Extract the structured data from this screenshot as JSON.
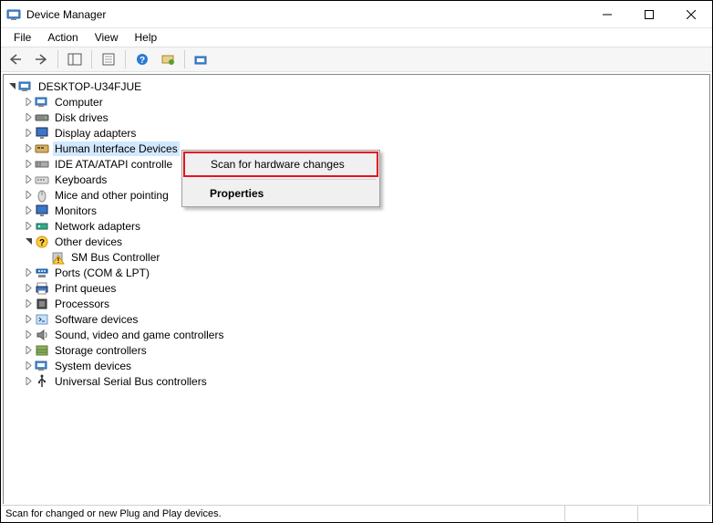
{
  "window": {
    "title": "Device Manager"
  },
  "menubar": {
    "file": "File",
    "action": "Action",
    "view": "View",
    "help": "Help"
  },
  "tree": {
    "root": "DESKTOP-U34FJUE",
    "nodes": [
      {
        "label": "Computer",
        "icon": "computer"
      },
      {
        "label": "Disk drives",
        "icon": "disk"
      },
      {
        "label": "Display adapters",
        "icon": "display"
      },
      {
        "label": "Human Interface Devices",
        "icon": "hid",
        "selected": true
      },
      {
        "label": "IDE ATA/ATAPI controllers",
        "icon": "ide",
        "truncated": "IDE ATA/ATAPI controlle"
      },
      {
        "label": "Keyboards",
        "icon": "keyboard"
      },
      {
        "label": "Mice and other pointing",
        "icon": "mouse"
      },
      {
        "label": "Monitors",
        "icon": "monitor"
      },
      {
        "label": "Network adapters",
        "icon": "network"
      },
      {
        "label": "Other devices",
        "icon": "other",
        "expanded": true,
        "children": [
          {
            "label": "SM Bus Controller",
            "icon": "warning"
          }
        ]
      },
      {
        "label": "Ports (COM & LPT)",
        "icon": "ports"
      },
      {
        "label": "Print queues",
        "icon": "printer"
      },
      {
        "label": "Processors",
        "icon": "cpu"
      },
      {
        "label": "Software devices",
        "icon": "software"
      },
      {
        "label": "Sound, video and game controllers",
        "icon": "sound"
      },
      {
        "label": "Storage controllers",
        "icon": "storage"
      },
      {
        "label": "System devices",
        "icon": "system"
      },
      {
        "label": "Universal Serial Bus controllers",
        "icon": "usb"
      }
    ]
  },
  "context_menu": {
    "scan": "Scan for hardware changes",
    "properties": "Properties"
  },
  "statusbar": {
    "text": "Scan for changed or new Plug and Play devices."
  }
}
